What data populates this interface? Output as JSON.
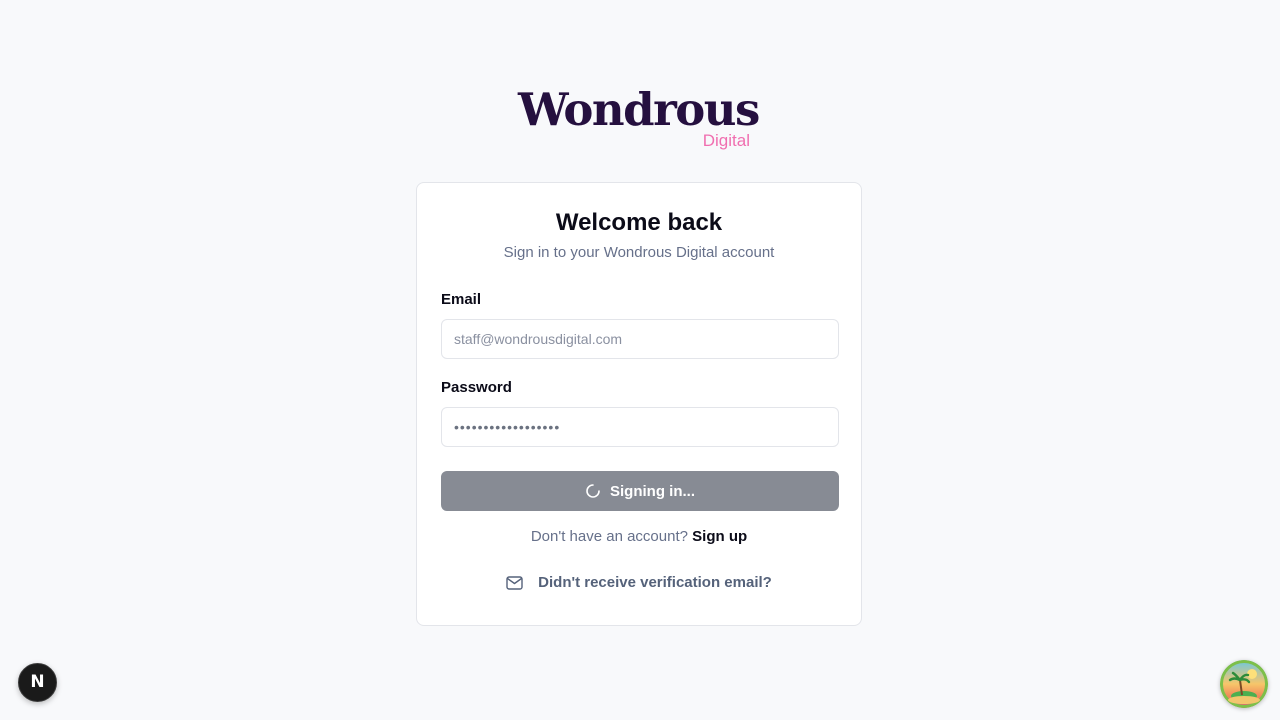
{
  "brand": {
    "name": "Wondrous",
    "tagline": "Digital",
    "colors": {
      "wordmark": "#25103f",
      "tagline": "#f06fb0"
    }
  },
  "card": {
    "title": "Welcome back",
    "subtitle": "Sign in to your Wondrous Digital account"
  },
  "form": {
    "email": {
      "label": "Email",
      "placeholder": "staff@wondrousdigital.com",
      "value": ""
    },
    "password": {
      "label": "Password",
      "masked_value": "••••••••••••••••••"
    },
    "submit": {
      "label": "Signing in...",
      "state": "loading",
      "icon": "spinner-icon",
      "color": "#878b94"
    }
  },
  "signup": {
    "prompt": "Don't have an account?",
    "link_label": "Sign up"
  },
  "verification": {
    "icon": "mail-icon",
    "label": "Didn't receive verification email?"
  },
  "dev_badge": {
    "letter": "N",
    "icon": "nextjs-icon"
  },
  "user_avatar": {
    "icon": "tropical-island-avatar"
  }
}
